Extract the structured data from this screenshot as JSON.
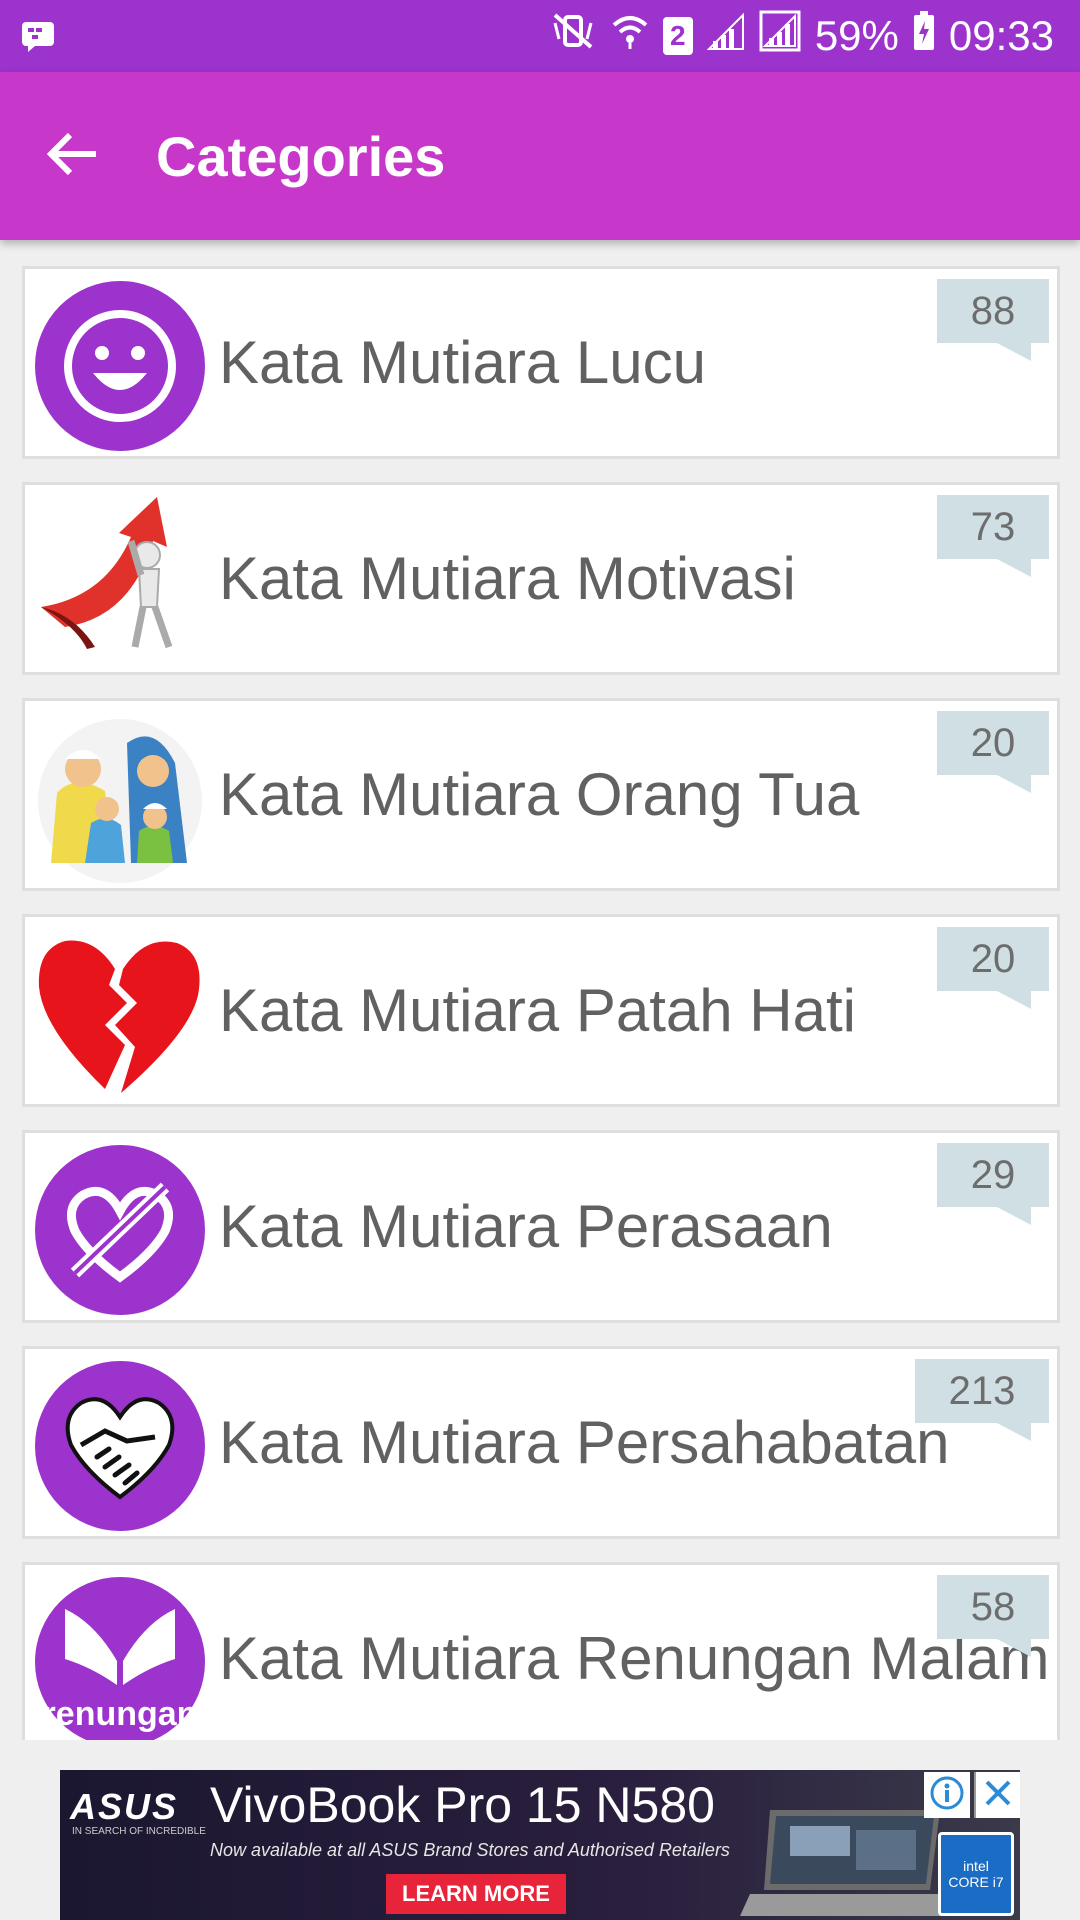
{
  "status_bar": {
    "battery_percent": "59%",
    "time": "09:33",
    "sim_slot": "2",
    "icons": [
      "bbm-notification-icon",
      "vibrate-mute-icon",
      "wifi-icon",
      "sim-2-icon",
      "signal-icon",
      "signal-icon",
      "battery-charging-icon"
    ]
  },
  "app_bar": {
    "title": "Categories",
    "back_icon": "arrow-left-icon"
  },
  "categories": [
    {
      "label": "Kata Mutiara Lucu",
      "count": "88",
      "icon": "smiley-icon"
    },
    {
      "label": "Kata Mutiara Motivasi",
      "count": "73",
      "icon": "motivation-arrow-icon"
    },
    {
      "label": "Kata Mutiara Orang Tua",
      "count": "20",
      "icon": "family-icon"
    },
    {
      "label": "Kata Mutiara Patah Hati",
      "count": "20",
      "icon": "broken-heart-icon"
    },
    {
      "label": "Kata Mutiara Perasaan",
      "count": "29",
      "icon": "crossed-heart-icon"
    },
    {
      "label": "Kata Mutiara Persahabatan",
      "count": "213",
      "icon": "handshake-heart-icon"
    },
    {
      "label": "Kata Mutiara Renungan Malam",
      "count": "58",
      "icon": "renungan-icon",
      "icon_text": "renungan"
    }
  ],
  "ad": {
    "brand": "ASUS",
    "brand_tagline": "IN SEARCH OF INCREDIBLE",
    "title": "VivoBook Pro 15 N580",
    "subtitle": "Now available at all ASUS Brand Stores and Authorised Retailers",
    "cta": "LEARN MORE",
    "badge_brand": "intel",
    "badge_model": "CORE i7"
  },
  "colors": {
    "status_bar": "#9b33cc",
    "app_bar": "#c737c9",
    "icon_purple": "#9b33cc",
    "badge_bg": "#cfdfe3",
    "label_text": "#616161"
  }
}
